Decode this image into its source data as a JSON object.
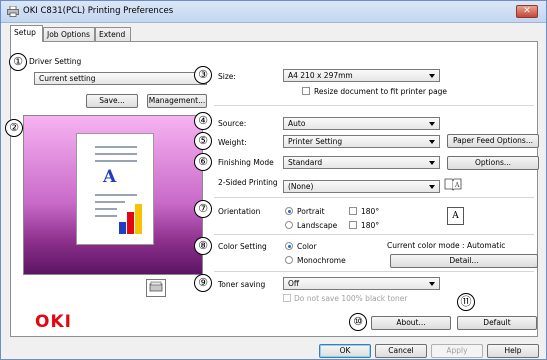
{
  "window": {
    "title": "OKI C831(PCL) Printing Preferences",
    "close_glyph": "✕"
  },
  "tabs": [
    {
      "label": "Setup"
    },
    {
      "label": "Job Options"
    },
    {
      "label": "Extend"
    }
  ],
  "callouts": [
    "①",
    "②",
    "③",
    "④",
    "⑤",
    "⑥",
    "⑦",
    "⑧",
    "⑨",
    "⑩",
    "⑪"
  ],
  "driver_setting": {
    "title": "Driver Setting",
    "value": "Current setting",
    "save_label": "Save...",
    "management_label": "Management..."
  },
  "preview": {
    "letter": "A"
  },
  "size": {
    "label": "Size:",
    "value": "A4 210 x 297mm",
    "resize_label": "Resize document to fit printer page"
  },
  "source": {
    "label": "Source:",
    "value": "Auto"
  },
  "weight": {
    "label": "Weight:",
    "value": "Printer Setting",
    "paper_feed_label": "Paper Feed Options..."
  },
  "finishing": {
    "label": "Finishing Mode",
    "value": "Standard",
    "options_label": "Options..."
  },
  "two_sided": {
    "label": "2-Sided Printing",
    "value": "(None)"
  },
  "orientation": {
    "label": "Orientation",
    "portrait": "Portrait",
    "landscape": "Landscape",
    "rotate": "180°",
    "icon_letter": "A"
  },
  "color_setting": {
    "label": "Color Setting",
    "color": "Color",
    "mono": "Monochrome",
    "current_mode": "Current color mode : Automatic",
    "detail_label": "Detail..."
  },
  "toner": {
    "label": "Toner saving",
    "value": "Off",
    "no_black_label": "Do not save 100% black toner"
  },
  "brand": {
    "logo": "OKI"
  },
  "footer": {
    "about_label": "About...",
    "default_label": "Default",
    "ok_label": "OK",
    "cancel_label": "Cancel",
    "apply_label": "Apply",
    "help_label": "Help"
  },
  "colors": {
    "brand_red": "#e30613",
    "selected_radio": "#1c6fd0",
    "preview_pink": "#f7b3f2",
    "preview_purple": "#8b2f8b"
  }
}
